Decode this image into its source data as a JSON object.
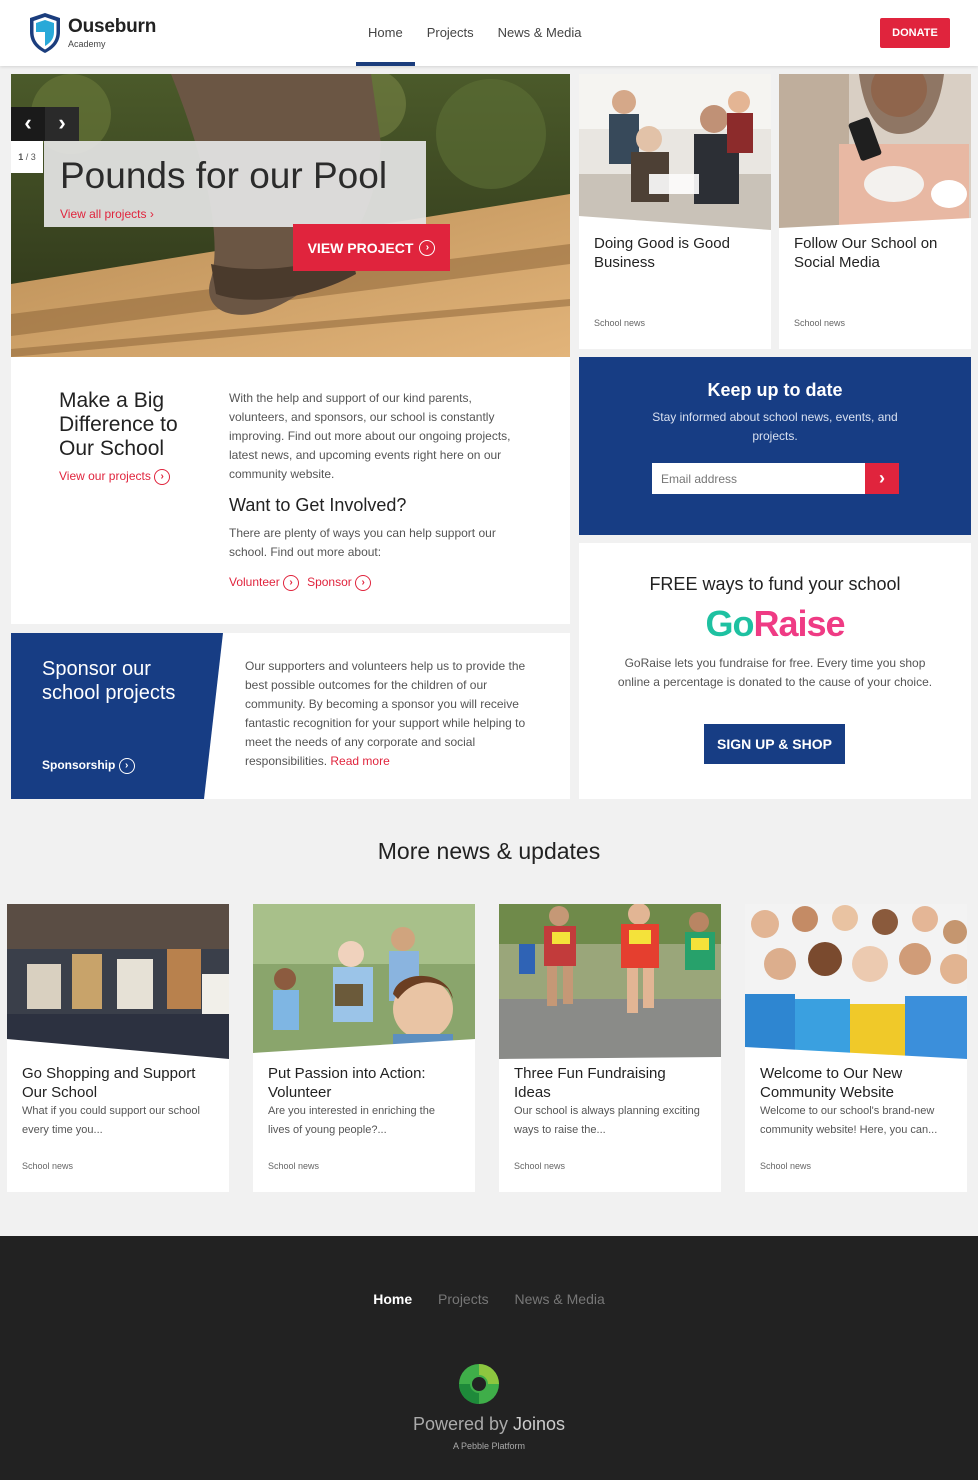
{
  "header": {
    "logo_name": "Ouseburn",
    "logo_sub": "Academy",
    "nav": [
      "Home",
      "Projects",
      "News & Media"
    ],
    "donate": "DONATE"
  },
  "hero": {
    "count_current": "1",
    "count_total": "/ 3",
    "title": "Pounds for our Pool",
    "link": "View all projects",
    "button": "VIEW PROJECT"
  },
  "top_cards": [
    {
      "title": "Doing Good is Good Business",
      "tag": "School news"
    },
    {
      "title": "Follow Our School on Social Media",
      "tag": "School news"
    }
  ],
  "info": {
    "heading": "Make a Big Difference to Our School",
    "link": "View our projects",
    "paragraph": "With the help and support of our kind parents, volunteers, and sponsors, our school is constantly improving. Find out more about our ongoing projects, latest news, and upcoming events right here on our community website.",
    "heading2": "Want to Get Involved?",
    "paragraph2": "There are plenty of ways you can help support our school. Find out more about:",
    "link_volunteer": "Volunteer",
    "link_sponsor": "Sponsor"
  },
  "keep": {
    "heading": "Keep up to date",
    "text": "Stay informed about school news, events, and projects.",
    "placeholder": "Email address"
  },
  "sponsor": {
    "heading": "Sponsor our school projects",
    "link": "Sponsorship",
    "paragraph": "Our supporters and volunteers help us to provide the best possible outcomes for the children of our community. By becoming a sponsor you will receive fantastic recognition for your support while helping to meet the needs of any corporate and social responsibilities.",
    "read_more": "Read more"
  },
  "goraise": {
    "heading": "FREE ways to fund your school",
    "logo_a": "Go",
    "logo_b": "Raise",
    "text": "GoRaise lets you fundraise for free. Every time you shop online a percentage is donated to the cause of your choice.",
    "button": "SIGN UP & SHOP"
  },
  "more": {
    "heading": "More news & updates",
    "cards": [
      {
        "title": "Go Shopping and Support Our School",
        "excerpt": "What if you could support our school every time you...",
        "tag": "School news"
      },
      {
        "title": "Put Passion into Action: Volunteer",
        "excerpt": "Are you interested in enriching the lives of young people?...",
        "tag": "School news"
      },
      {
        "title": "Three Fun Fundraising Ideas",
        "excerpt": "Our school is always planning exciting ways to raise the...",
        "tag": "School news"
      },
      {
        "title": "Welcome to Our New Community Website",
        "excerpt": "Welcome to our school's brand-new community website! Here, you can...",
        "tag": "School news"
      }
    ]
  },
  "footer": {
    "nav": [
      "Home",
      "Projects",
      "News & Media"
    ],
    "powered": "Powered by",
    "brand": "Joinos",
    "sub": "A Pebble Platform"
  },
  "colors": {
    "navy": "#173d84",
    "red": "#e0243d",
    "footer": "#222222",
    "goraise_green": "#1ec1a1",
    "goraise_pink": "#ef3b84"
  }
}
